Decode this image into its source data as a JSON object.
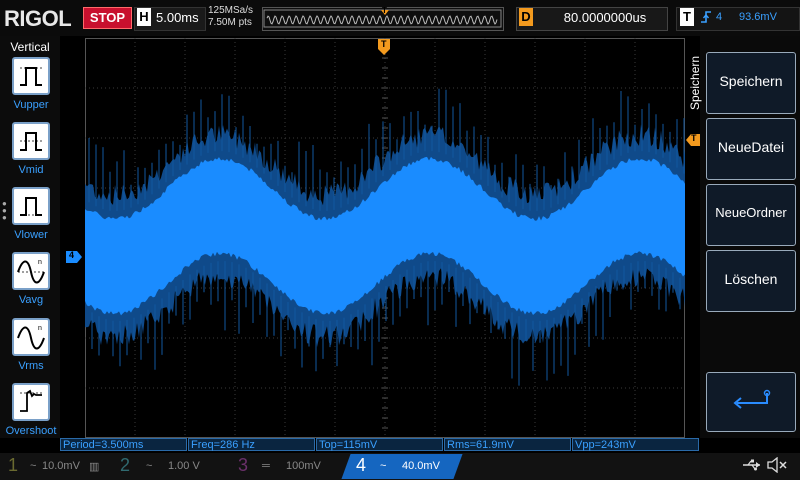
{
  "header": {
    "logo": "RIGOL",
    "run_state": "STOP",
    "horizontal": {
      "letter": "H",
      "time_base": "5.00ms"
    },
    "sample_rate": "125MSa/s",
    "memory_depth": "7.50M pts",
    "trigger_marker": "T",
    "delay": {
      "letter": "D",
      "value": "80.0000000us"
    },
    "trigger": {
      "letter": "T",
      "edge_icon": "rising-edge-icon",
      "channel": "4",
      "level": "93.6mV"
    }
  },
  "left_menu": {
    "title": "Vertical",
    "items": [
      {
        "label": "Vupper",
        "icon": "vupper-icon"
      },
      {
        "label": "Vmid",
        "icon": "vmid-icon"
      },
      {
        "label": "Vlower",
        "icon": "vlower-icon"
      },
      {
        "label": "Vavg",
        "icon": "vavg-icon"
      },
      {
        "label": "Vrms",
        "icon": "vrms-icon"
      },
      {
        "label": "Overshoot",
        "icon": "overshoot-icon"
      }
    ]
  },
  "right_menu": {
    "title": "Speichern",
    "items": [
      "Speichern",
      "NeueDatei",
      "NeueOrdner",
      "Löschen"
    ],
    "back_icon": "return-arrow-icon"
  },
  "markers": {
    "channel_marker": "4",
    "trigger_level_marker": "T"
  },
  "measurements": [
    "Period=3.500ms",
    "Freq=286 Hz",
    "Top=115mV",
    "Rms=61.9mV",
    "Vpp=243mV"
  ],
  "channels": [
    {
      "num": "1",
      "value": "10.0mV",
      "color": "#f0e040"
    },
    {
      "num": "2",
      "value": "1.00 V",
      "color": "#40e8ff"
    },
    {
      "num": "3",
      "value": "100mV",
      "color": "#e040e0"
    },
    {
      "num": "4",
      "value": "40.0mV",
      "color": "#1a8cff",
      "active": true
    }
  ],
  "colors": {
    "accent": "#1a8cff",
    "trigger": "#f39a1e",
    "stop": "#c8102e"
  }
}
